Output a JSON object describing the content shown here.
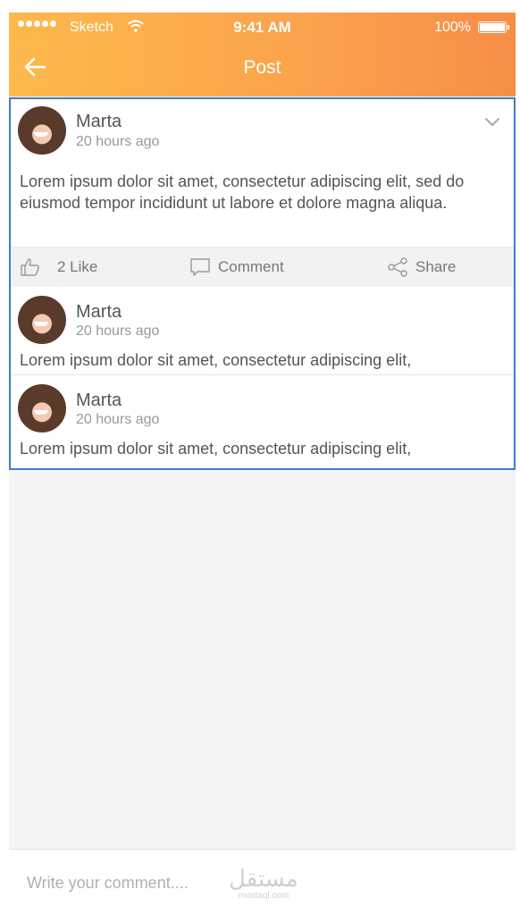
{
  "status_bar": {
    "carrier": "Sketch",
    "time": "9:41 AM",
    "battery_pct": "100%"
  },
  "header": {
    "title": "Post"
  },
  "post": {
    "author": "Marta",
    "time_ago": "20 hours ago",
    "text": "Lorem ipsum dolor sit amet, consectetur adipiscing elit, sed do eiusmod tempor incididunt ut labore et dolore magna aliqua.",
    "like_label": "2 Like",
    "comment_label": "Comment",
    "share_label": "Share"
  },
  "replies": [
    {
      "author": "Marta",
      "time_ago": "20 hours ago",
      "text": "Lorem ipsum dolor sit amet, consectetur adipiscing elit,"
    },
    {
      "author": "Marta",
      "time_ago": "20 hours ago",
      "text": "Lorem ipsum dolor sit amet, consectetur adipiscing elit,"
    }
  ],
  "composer": {
    "placeholder": "Write your comment...."
  },
  "watermark": {
    "arabic": "مستقل",
    "latin": "mostaql.com"
  },
  "colors": {
    "header_start": "#fcb94c",
    "header_end": "#f78d47",
    "selection_border": "#3b7fd0"
  }
}
